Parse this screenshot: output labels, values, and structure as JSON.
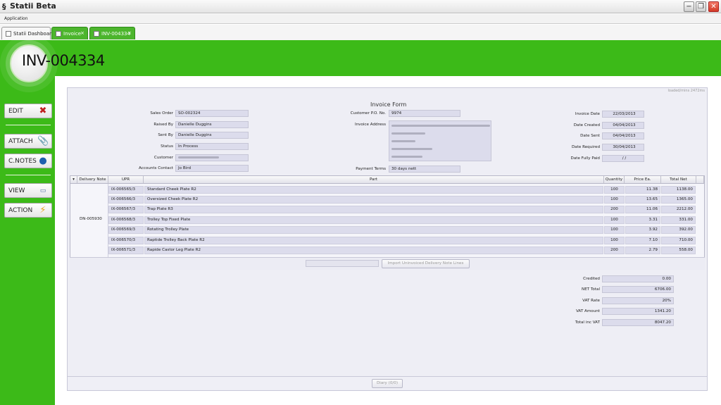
{
  "window": {
    "title": "Statii Beta"
  },
  "menubar": {
    "application": "Application"
  },
  "tabs": [
    {
      "label": "Statii Dashboard"
    },
    {
      "label": "Invoice"
    },
    {
      "label": "INV-004334"
    }
  ],
  "header": {
    "invoice_number": "INV-004334"
  },
  "sidebar": {
    "edit": "EDIT",
    "attach": "ATTACH",
    "cnotes": "C.NOTES",
    "view": "VIEW",
    "action": "ACTION"
  },
  "status": {
    "loaded": "loaded/mins 2472ms"
  },
  "form": {
    "title": "Invoice Form",
    "sales_order_label": "Sales Order",
    "sales_order": "SO-002324",
    "raised_by_label": "Raised By",
    "raised_by": "Danielle Duggins",
    "sent_by_label": "Sent By",
    "sent_by": "Danielle Duggins",
    "status_label": "Status",
    "status": "In Process",
    "customer_label": "Customer",
    "accounts_contact_label": "Accounts Contact",
    "accounts_contact": "Jo Bird",
    "customer_po_label": "Customer P.O. No.",
    "customer_po": "9974",
    "invoice_address_label": "Invoice Address",
    "payment_terms_label": "Payment Terms",
    "payment_terms": "30 days nett",
    "invoice_date_label": "Invoice Date",
    "invoice_date": "22/03/2013",
    "date_created_label": "Date Created",
    "date_created": "04/04/2013",
    "date_sent_label": "Date Sent",
    "date_sent": "04/04/2013",
    "date_required_label": "Date Required",
    "date_required": "30/04/2013",
    "date_fully_paid_label": "Date Fully Paid",
    "date_fully_paid": "/ /"
  },
  "grid": {
    "headers": [
      "Delivery Note",
      "UPR",
      "Part",
      "Quantity",
      "Price Ea.",
      "Total Net"
    ],
    "rows": [
      {
        "delivery_note": "",
        "upr": "IX-006565/3",
        "part": "Standard Cheek Plate R2",
        "quantity": "100",
        "price": "11.38",
        "total": "1138.00"
      },
      {
        "delivery_note": "",
        "upr": "IX-006566/3",
        "part": "Oversized Cheek Plate R2",
        "quantity": "100",
        "price": "13.65",
        "total": "1365.00"
      },
      {
        "delivery_note": "",
        "upr": "IX-006567/3",
        "part": "Trap Plate R3",
        "quantity": "200",
        "price": "11.06",
        "total": "2212.00"
      },
      {
        "delivery_note": "DN-005930",
        "upr": "IX-006568/3",
        "part": "Trolley Top Fixed Plate",
        "quantity": "100",
        "price": "3.31",
        "total": "331.00"
      },
      {
        "delivery_note": "",
        "upr": "IX-006569/3",
        "part": "Rotating Trolley Plate",
        "quantity": "100",
        "price": "3.92",
        "total": "392.00"
      },
      {
        "delivery_note": "",
        "upr": "IX-006570/3",
        "part": "Raptide Trolley Back Plate R2",
        "quantity": "100",
        "price": "7.10",
        "total": "710.00"
      },
      {
        "delivery_note": "",
        "upr": "IX-006571/3",
        "part": "Rapide Castor Leg Plate R2",
        "quantity": "200",
        "price": "2.79",
        "total": "558.00"
      }
    ]
  },
  "import_button": "Import Uninvoiced Delivery Note Lines",
  "totals": {
    "credited_label": "Credited",
    "credited": "0.00",
    "net_total_label": "NET Total",
    "net_total": "6706.00",
    "vat_rate_label": "VAT Rate",
    "vat_rate": "20%",
    "vat_amount_label": "VAT Amount",
    "vat_amount": "1341.20",
    "total_inc_vat_label": "Total inc VAT",
    "total_inc_vat": "8047.20"
  },
  "diary_button": "Diary (0/0)"
}
